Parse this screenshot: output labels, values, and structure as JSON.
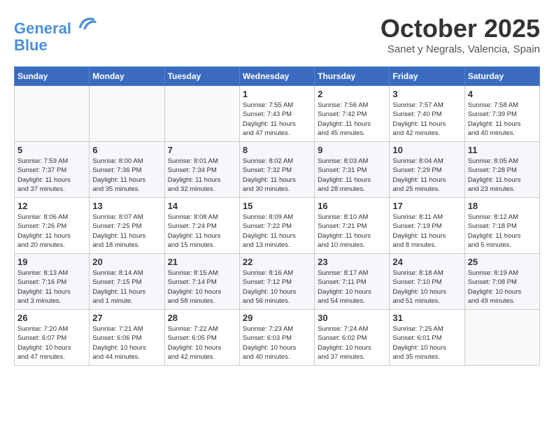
{
  "header": {
    "logo_line1": "General",
    "logo_line2": "Blue",
    "month": "October 2025",
    "location": "Sanet y Negrals, Valencia, Spain"
  },
  "weekdays": [
    "Sunday",
    "Monday",
    "Tuesday",
    "Wednesday",
    "Thursday",
    "Friday",
    "Saturday"
  ],
  "weeks": [
    [
      {
        "day": "",
        "info": ""
      },
      {
        "day": "",
        "info": ""
      },
      {
        "day": "",
        "info": ""
      },
      {
        "day": "1",
        "info": "Sunrise: 7:55 AM\nSunset: 7:43 PM\nDaylight: 11 hours\nand 47 minutes."
      },
      {
        "day": "2",
        "info": "Sunrise: 7:56 AM\nSunset: 7:42 PM\nDaylight: 11 hours\nand 45 minutes."
      },
      {
        "day": "3",
        "info": "Sunrise: 7:57 AM\nSunset: 7:40 PM\nDaylight: 11 hours\nand 42 minutes."
      },
      {
        "day": "4",
        "info": "Sunrise: 7:58 AM\nSunset: 7:39 PM\nDaylight: 11 hours\nand 40 minutes."
      }
    ],
    [
      {
        "day": "5",
        "info": "Sunrise: 7:59 AM\nSunset: 7:37 PM\nDaylight: 11 hours\nand 37 minutes."
      },
      {
        "day": "6",
        "info": "Sunrise: 8:00 AM\nSunset: 7:36 PM\nDaylight: 11 hours\nand 35 minutes."
      },
      {
        "day": "7",
        "info": "Sunrise: 8:01 AM\nSunset: 7:34 PM\nDaylight: 11 hours\nand 32 minutes."
      },
      {
        "day": "8",
        "info": "Sunrise: 8:02 AM\nSunset: 7:32 PM\nDaylight: 11 hours\nand 30 minutes."
      },
      {
        "day": "9",
        "info": "Sunrise: 8:03 AM\nSunset: 7:31 PM\nDaylight: 11 hours\nand 28 minutes."
      },
      {
        "day": "10",
        "info": "Sunrise: 8:04 AM\nSunset: 7:29 PM\nDaylight: 11 hours\nand 25 minutes."
      },
      {
        "day": "11",
        "info": "Sunrise: 8:05 AM\nSunset: 7:28 PM\nDaylight: 11 hours\nand 23 minutes."
      }
    ],
    [
      {
        "day": "12",
        "info": "Sunrise: 8:06 AM\nSunset: 7:26 PM\nDaylight: 11 hours\nand 20 minutes."
      },
      {
        "day": "13",
        "info": "Sunrise: 8:07 AM\nSunset: 7:25 PM\nDaylight: 11 hours\nand 18 minutes."
      },
      {
        "day": "14",
        "info": "Sunrise: 8:08 AM\nSunset: 7:24 PM\nDaylight: 11 hours\nand 15 minutes."
      },
      {
        "day": "15",
        "info": "Sunrise: 8:09 AM\nSunset: 7:22 PM\nDaylight: 11 hours\nand 13 minutes."
      },
      {
        "day": "16",
        "info": "Sunrise: 8:10 AM\nSunset: 7:21 PM\nDaylight: 11 hours\nand 10 minutes."
      },
      {
        "day": "17",
        "info": "Sunrise: 8:11 AM\nSunset: 7:19 PM\nDaylight: 11 hours\nand 8 minutes."
      },
      {
        "day": "18",
        "info": "Sunrise: 8:12 AM\nSunset: 7:18 PM\nDaylight: 11 hours\nand 5 minutes."
      }
    ],
    [
      {
        "day": "19",
        "info": "Sunrise: 8:13 AM\nSunset: 7:16 PM\nDaylight: 11 hours\nand 3 minutes."
      },
      {
        "day": "20",
        "info": "Sunrise: 8:14 AM\nSunset: 7:15 PM\nDaylight: 11 hours\nand 1 minute."
      },
      {
        "day": "21",
        "info": "Sunrise: 8:15 AM\nSunset: 7:14 PM\nDaylight: 10 hours\nand 58 minutes."
      },
      {
        "day": "22",
        "info": "Sunrise: 8:16 AM\nSunset: 7:12 PM\nDaylight: 10 hours\nand 56 minutes."
      },
      {
        "day": "23",
        "info": "Sunrise: 8:17 AM\nSunset: 7:11 PM\nDaylight: 10 hours\nand 54 minutes."
      },
      {
        "day": "24",
        "info": "Sunrise: 8:18 AM\nSunset: 7:10 PM\nDaylight: 10 hours\nand 51 minutes."
      },
      {
        "day": "25",
        "info": "Sunrise: 8:19 AM\nSunset: 7:08 PM\nDaylight: 10 hours\nand 49 minutes."
      }
    ],
    [
      {
        "day": "26",
        "info": "Sunrise: 7:20 AM\nSunset: 6:07 PM\nDaylight: 10 hours\nand 47 minutes."
      },
      {
        "day": "27",
        "info": "Sunrise: 7:21 AM\nSunset: 6:06 PM\nDaylight: 10 hours\nand 44 minutes."
      },
      {
        "day": "28",
        "info": "Sunrise: 7:22 AM\nSunset: 6:05 PM\nDaylight: 10 hours\nand 42 minutes."
      },
      {
        "day": "29",
        "info": "Sunrise: 7:23 AM\nSunset: 6:03 PM\nDaylight: 10 hours\nand 40 minutes."
      },
      {
        "day": "30",
        "info": "Sunrise: 7:24 AM\nSunset: 6:02 PM\nDaylight: 10 hours\nand 37 minutes."
      },
      {
        "day": "31",
        "info": "Sunrise: 7:25 AM\nSunset: 6:01 PM\nDaylight: 10 hours\nand 35 minutes."
      },
      {
        "day": "",
        "info": ""
      }
    ]
  ]
}
